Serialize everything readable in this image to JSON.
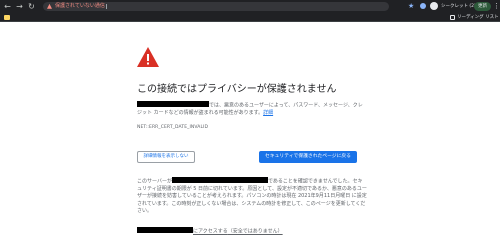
{
  "browser": {
    "address_warning": "保護されていない通信",
    "profile_name": "シークレット (2)",
    "update_label": "更新",
    "reading_list_label": "リーディング リスト"
  },
  "interstitial": {
    "headline": "この接続ではプライバシーが保護されません",
    "explanation_after_redaction": "では、悪意のあるユーザーによって、パスワード、メッセージ、クレジット カードなどの情報が盗まれる可能性があります。",
    "details_link": "詳細",
    "error_code": "NET::ERR_CERT_DATE_INVALID",
    "advanced_button": "詳細情報を表示しない",
    "back_button": "セキュリティで保護されたページに戻る",
    "details_prefix": "このサーバーが",
    "details_body": "であることを確認できませんでした。セキュリティ証明書の期限が 5 日前に切れています。原因として、設定が不適切であるか、悪意のあるユーザーが接続を妨害していることが考えられます。パソコンの時計は現在 2021年9月11日月曜日 に設定されています。この時刻が正しくない場合は、システムの時計を修正して、このページを更新してください。",
    "proceed_link": "にアクセスする",
    "proceed_suffix": "（安全ではありません）"
  },
  "colors": {
    "chrome_bg": "#202124",
    "warning_red": "#d93025",
    "link_blue": "#1a73e8",
    "body_text": "#5f6368"
  }
}
